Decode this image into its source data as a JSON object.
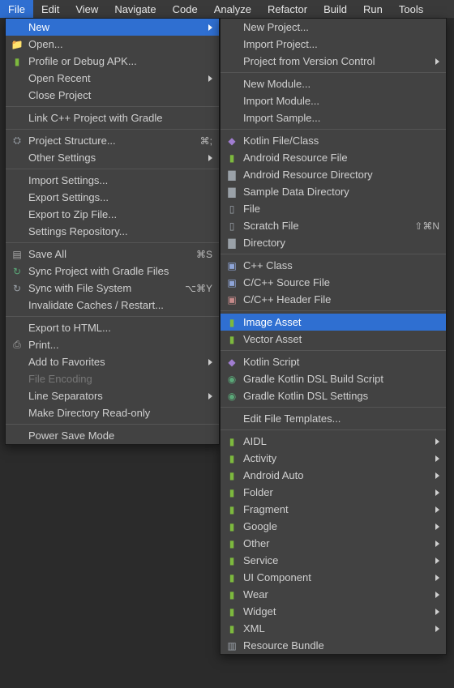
{
  "menubar": [
    "File",
    "Edit",
    "View",
    "Navigate",
    "Code",
    "Analyze",
    "Refactor",
    "Build",
    "Run",
    "Tools"
  ],
  "active_menubar_index": 0,
  "file_menu": {
    "groups": [
      [
        {
          "label": "New",
          "selected": true,
          "submenu": true
        },
        {
          "label": "Open...",
          "icon": "folder"
        },
        {
          "label": "Profile or Debug APK...",
          "icon": "android"
        },
        {
          "label": "Open Recent",
          "submenu": true
        },
        {
          "label": "Close Project"
        }
      ],
      [
        {
          "label": "Link C++ Project with Gradle"
        }
      ],
      [
        {
          "label": "Project Structure...",
          "icon": "structure",
          "shortcut": "⌘;"
        },
        {
          "label": "Other Settings",
          "submenu": true
        }
      ],
      [
        {
          "label": "Import Settings..."
        },
        {
          "label": "Export Settings..."
        },
        {
          "label": "Export to Zip File..."
        },
        {
          "label": "Settings Repository..."
        }
      ],
      [
        {
          "label": "Save All",
          "icon": "save",
          "shortcut": "⌘S"
        },
        {
          "label": "Sync Project with Gradle Files",
          "icon": "sync"
        },
        {
          "label": "Sync with File System",
          "icon": "sync2",
          "shortcut": "⌥⌘Y"
        },
        {
          "label": "Invalidate Caches / Restart..."
        }
      ],
      [
        {
          "label": "Export to HTML..."
        },
        {
          "label": "Print...",
          "icon": "print"
        },
        {
          "label": "Add to Favorites",
          "submenu": true
        },
        {
          "label": "File Encoding",
          "disabled": true
        },
        {
          "label": "Line Separators",
          "submenu": true
        },
        {
          "label": "Make Directory Read-only"
        }
      ],
      [
        {
          "label": "Power Save Mode"
        }
      ]
    ]
  },
  "new_menu": {
    "groups": [
      [
        {
          "label": "New Project..."
        },
        {
          "label": "Import Project..."
        },
        {
          "label": "Project from Version Control",
          "submenu": true
        }
      ],
      [
        {
          "label": "New Module..."
        },
        {
          "label": "Import Module..."
        },
        {
          "label": "Import Sample..."
        }
      ],
      [
        {
          "label": "Kotlin File/Class",
          "icon": "kotlin"
        },
        {
          "label": "Android Resource File",
          "icon": "android"
        },
        {
          "label": "Android Resource Directory",
          "icon": "folder-alt"
        },
        {
          "label": "Sample Data Directory",
          "icon": "folder-alt"
        },
        {
          "label": "File",
          "icon": "file"
        },
        {
          "label": "Scratch File",
          "icon": "file",
          "shortcut": "⇧⌘N"
        },
        {
          "label": "Directory",
          "icon": "folder-alt"
        }
      ],
      [
        {
          "label": "C++ Class",
          "icon": "cpp"
        },
        {
          "label": "C/C++ Source File",
          "icon": "cpp"
        },
        {
          "label": "C/C++ Header File",
          "icon": "header"
        }
      ],
      [
        {
          "label": "Image Asset",
          "icon": "android",
          "selected": true
        },
        {
          "label": "Vector Asset",
          "icon": "android"
        }
      ],
      [
        {
          "label": "Kotlin Script",
          "icon": "kotlin"
        },
        {
          "label": "Gradle Kotlin DSL Build Script",
          "icon": "gradle"
        },
        {
          "label": "Gradle Kotlin DSL Settings",
          "icon": "gradle"
        }
      ],
      [
        {
          "label": "Edit File Templates..."
        }
      ],
      [
        {
          "label": "AIDL",
          "icon": "android",
          "submenu": true
        },
        {
          "label": "Activity",
          "icon": "android",
          "submenu": true
        },
        {
          "label": "Android Auto",
          "icon": "android",
          "submenu": true
        },
        {
          "label": "Folder",
          "icon": "android",
          "submenu": true
        },
        {
          "label": "Fragment",
          "icon": "android",
          "submenu": true
        },
        {
          "label": "Google",
          "icon": "android",
          "submenu": true
        },
        {
          "label": "Other",
          "icon": "android",
          "submenu": true
        },
        {
          "label": "Service",
          "icon": "android",
          "submenu": true
        },
        {
          "label": "UI Component",
          "icon": "android",
          "submenu": true
        },
        {
          "label": "Wear",
          "icon": "android",
          "submenu": true
        },
        {
          "label": "Widget",
          "icon": "android",
          "submenu": true
        },
        {
          "label": "XML",
          "icon": "android",
          "submenu": true
        },
        {
          "label": "Resource Bundle",
          "icon": "bundle"
        }
      ]
    ]
  }
}
